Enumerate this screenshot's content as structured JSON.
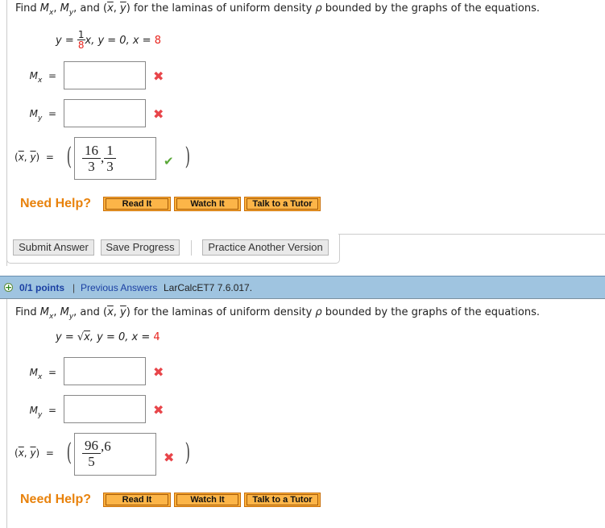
{
  "question1": {
    "prompt": {
      "find": "Find ",
      "m": "M",
      "x": "x",
      "y": "y",
      "comma": ", ",
      "and": ", and ",
      "xbar": "x",
      "ybar": "y",
      "rest": " for the laminas of uniform density ",
      "rho": "ρ",
      "tail": " bounded by the graphs of the equations."
    },
    "equation": {
      "lhs": "y = ",
      "frac_num": "1",
      "frac_den": "8",
      "after_frac": "x, y = 0, x = ",
      "x_value": "8"
    },
    "mx": {
      "label": "M",
      "sub": "x",
      "eq": "=",
      "value": "",
      "status": "incorrect",
      "status_glyph": "✖"
    },
    "my": {
      "label": "M",
      "sub": "y",
      "eq": "=",
      "value": "",
      "status": "incorrect",
      "status_glyph": "✖"
    },
    "centroid": {
      "label_x": "x",
      "label_y": "y",
      "eq": "=",
      "open_paren": "(",
      "close_paren": ")",
      "answer": {
        "frac1_num": "16",
        "frac1_den": "3",
        "sep": ",",
        "frac2_num": "1",
        "frac2_den": "3"
      },
      "status": "correct",
      "status_glyph": "✔"
    },
    "help": {
      "label": "Need Help?",
      "buttons": [
        "Read It",
        "Watch It",
        "Talk to a Tutor"
      ]
    },
    "actions": {
      "submit": "Submit Answer",
      "save": "Save Progress",
      "practice": "Practice Another Version"
    }
  },
  "question2": {
    "header": {
      "points": "0/1 points",
      "separator": "|",
      "previous_answers": "Previous Answers",
      "source": "LarCalcET7 7.6.017."
    },
    "prompt": {
      "find": "Find ",
      "m": "M",
      "x": "x",
      "y": "y",
      "comma": ", ",
      "and": ", and ",
      "xbar": "x",
      "ybar": "y",
      "rest": " for the laminas of uniform density ",
      "rho": "ρ",
      "tail": " bounded by the graphs of the equations."
    },
    "equation": {
      "lhs": "y = ",
      "sqrt": "√",
      "radicand": "x",
      "after": ", y = 0, x = ",
      "x_value": "4"
    },
    "mx": {
      "label": "M",
      "sub": "x",
      "eq": "=",
      "value": "",
      "status": "incorrect",
      "status_glyph": "✖"
    },
    "my": {
      "label": "M",
      "sub": "y",
      "eq": "=",
      "value": "",
      "status": "incorrect",
      "status_glyph": "✖"
    },
    "centroid": {
      "label_x": "x",
      "label_y": "y",
      "eq": "=",
      "open_paren": "(",
      "close_paren": ")",
      "answer": {
        "frac1_num": "96",
        "frac1_den": "5",
        "rest": ",6"
      },
      "status": "incorrect",
      "status_glyph": "✖"
    },
    "help": {
      "label": "Need Help?",
      "buttons": [
        "Read It",
        "Watch It",
        "Talk to a Tutor"
      ]
    }
  },
  "colors": {
    "accent_orange": "#e8820c",
    "button_orange": "#fbb03b",
    "header_blue": "#9fc4e0",
    "link_blue": "#1a3fa3",
    "incorrect_red": "#e8454a",
    "correct_green": "#5aa838",
    "highlight_red": "#e8251f"
  }
}
